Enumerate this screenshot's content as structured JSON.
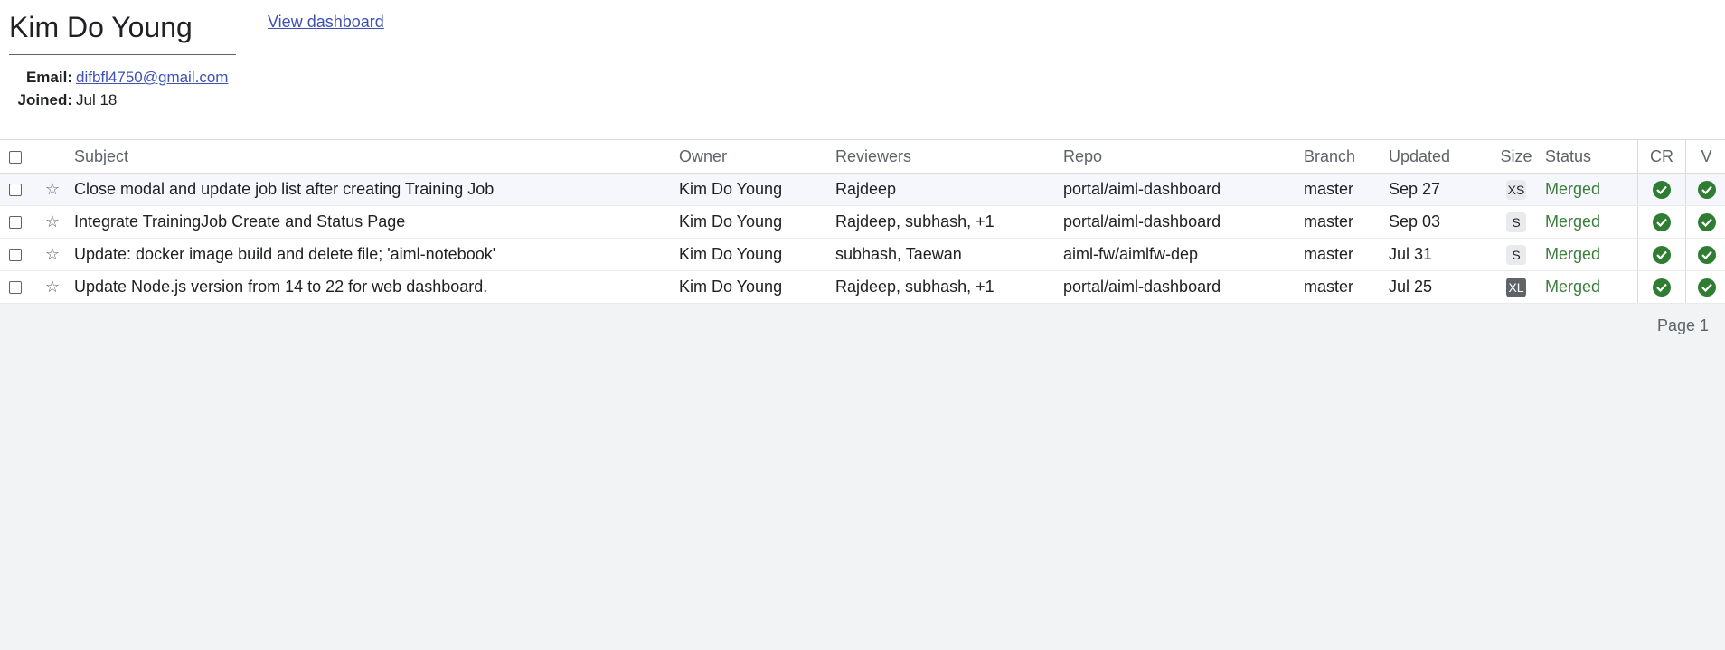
{
  "user": {
    "name": "Kim Do Young",
    "email_label": "Email:",
    "email": "difbfl4750@gmail.com",
    "joined_label": "Joined:",
    "joined": "Jul 18"
  },
  "dashboard_link": "View dashboard",
  "columns": {
    "subject": "Subject",
    "owner": "Owner",
    "reviewers": "Reviewers",
    "repo": "Repo",
    "branch": "Branch",
    "updated": "Updated",
    "size": "Size",
    "status": "Status",
    "cr": "CR",
    "v": "V"
  },
  "rows": [
    {
      "subject": "Close modal and update job list after creating Training Job",
      "owner": "Kim Do Young",
      "reviewers": "Rajdeep",
      "repo": "portal/aiml-dashboard",
      "branch": "master",
      "updated": "Sep 27",
      "size": "XS",
      "status": "Merged"
    },
    {
      "subject": "Integrate TrainingJob Create and Status Page",
      "owner": "Kim Do Young",
      "reviewers": "Rajdeep, subhash, +1",
      "repo": "portal/aiml-dashboard",
      "branch": "master",
      "updated": "Sep 03",
      "size": "S",
      "status": "Merged"
    },
    {
      "subject": "Update: docker image build and delete file; 'aiml-notebook'",
      "owner": "Kim Do Young",
      "reviewers": "subhash, Taewan",
      "repo": "aiml-fw/aimlfw-dep",
      "branch": "master",
      "updated": "Jul 31",
      "size": "S",
      "status": "Merged"
    },
    {
      "subject": "Update Node.js version from 14 to 22 for web dashboard.",
      "owner": "Kim Do Young",
      "reviewers": "Rajdeep, subhash, +1",
      "repo": "portal/aiml-dashboard",
      "branch": "master",
      "updated": "Jul 25",
      "size": "XL",
      "status": "Merged"
    }
  ],
  "footer": {
    "page": "Page 1"
  }
}
